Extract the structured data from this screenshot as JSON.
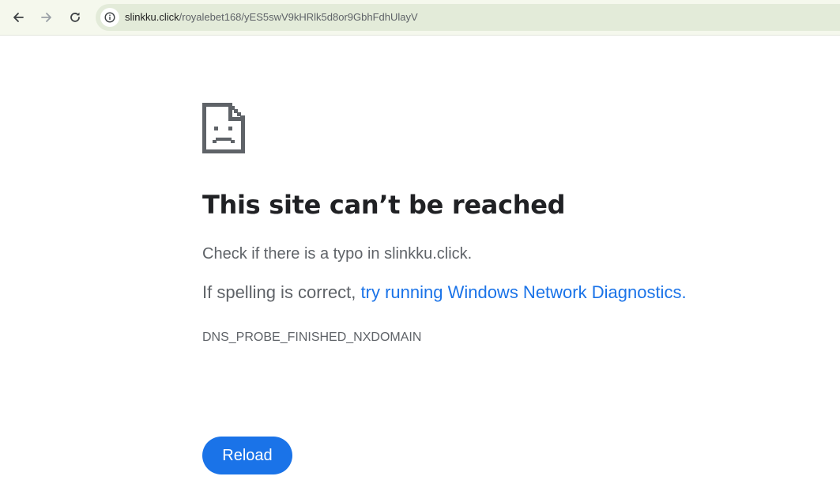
{
  "browser": {
    "back_icon": "arrow-left-icon",
    "forward_icon": "arrow-right-icon",
    "reload_icon": "refresh-icon",
    "site_info_icon": "info-circle-icon",
    "url_host": "slinkku.click",
    "url_path": "/royalebet168/yES5swV9kHRlk5d8or9GbhFdhUlayV"
  },
  "error_page": {
    "icon": "sad-document-icon",
    "heading": "This site can’t be reached",
    "check_text": "Check if there is a typo in slinkku.click.",
    "spelling_prefix": "If spelling is correct, ",
    "diagnostics_link": "try running Windows Network Diagnostics",
    "diagnostics_suffix": ".",
    "error_code": "DNS_PROBE_FINISHED_NXDOMAIN",
    "reload_label": "Reload"
  },
  "colors": {
    "toolbar_bg": "#f5f8ed",
    "omnibox_bg": "#e3ebd9",
    "link": "#1a73e8",
    "button_bg": "#1a73e8",
    "heading": "#202124",
    "body_text": "#5f6368"
  }
}
